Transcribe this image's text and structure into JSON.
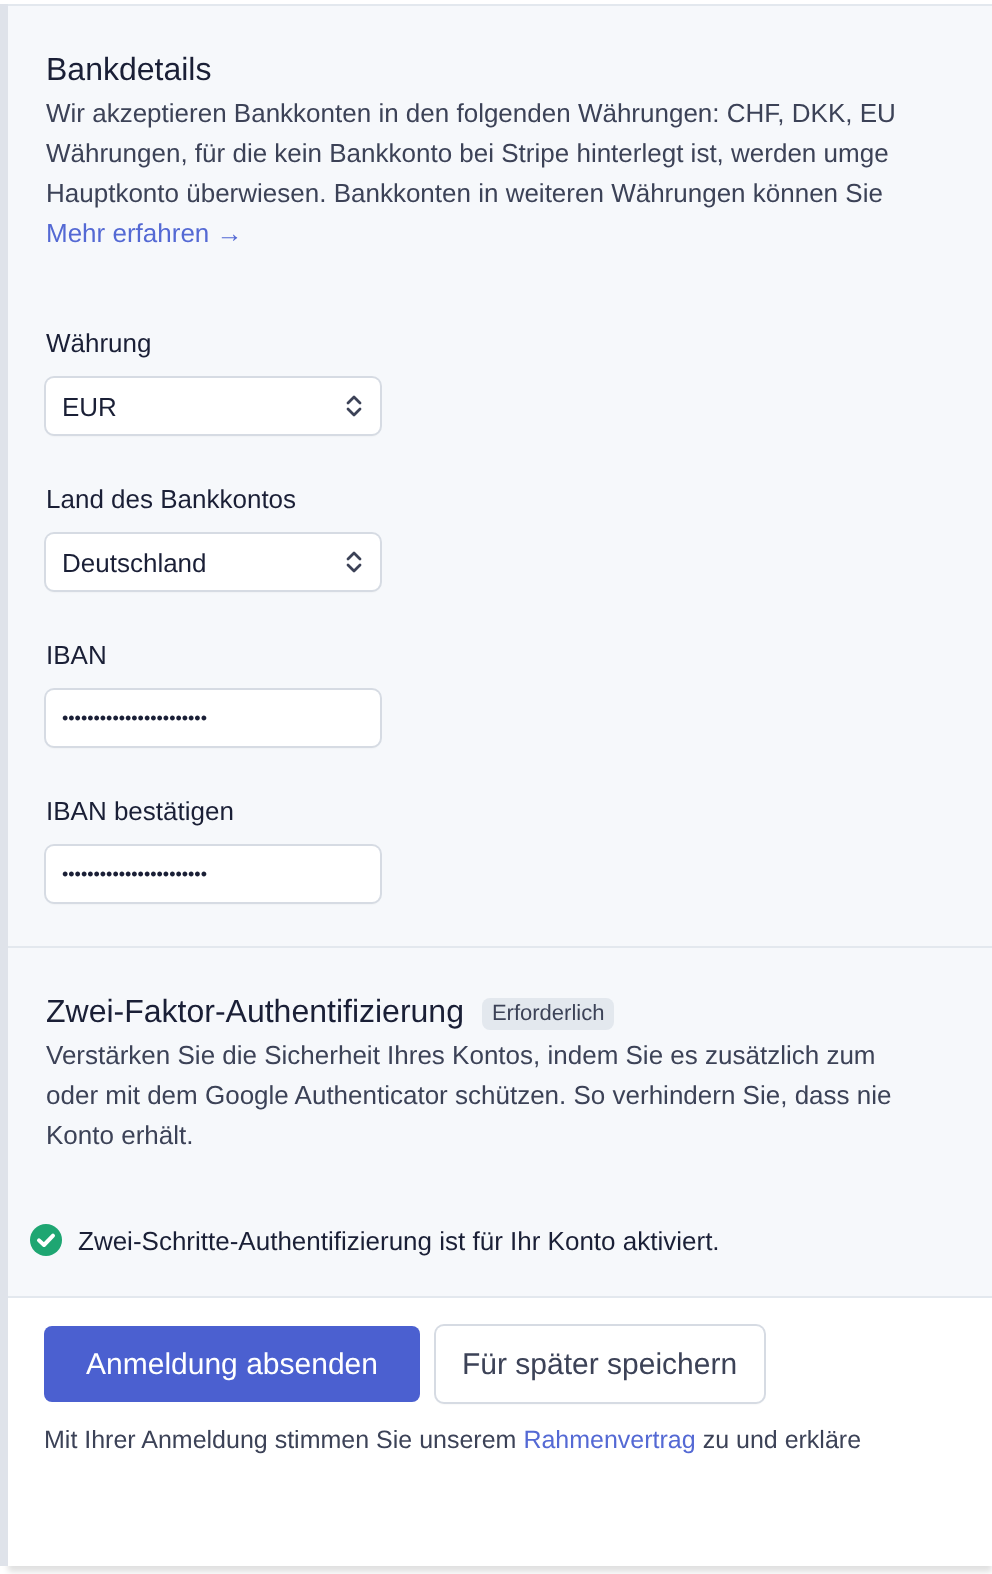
{
  "bank_details": {
    "title": "Bankdetails",
    "description_lines": [
      "Wir akzeptieren Bankkonten in den folgenden Währungen: CHF, DKK, EU",
      "Währungen, für die kein Bankkonto bei Stripe hinterlegt ist, werden umge",
      "Hauptkonto überwiesen. Bankkonten in weiteren Währungen können Sie"
    ],
    "link": "Mehr erfahren →",
    "fields": [
      {
        "kind": "select",
        "label": "Währung",
        "value": "EUR"
      },
      {
        "kind": "select",
        "label": "Land des Bankkontos",
        "value": "Deutschland"
      },
      {
        "kind": "masked",
        "label": "IBAN",
        "value": "•••••••••••••••••••••••"
      },
      {
        "kind": "masked",
        "label": "IBAN bestätigen",
        "value": "•••••••••••••••••••••••"
      }
    ]
  },
  "two_factor": {
    "title": "Zwei-Faktor-Authentifizierung",
    "badge": "Erforderlich",
    "description_lines": [
      "Verstärken Sie die Sicherheit Ihres Kontos, indem Sie es zusätzlich zum",
      "oder mit dem Google Authenticator schützen. So verhindern Sie, dass nie",
      "Konto erhält."
    ],
    "status": {
      "enabled": true,
      "text": "Zwei-Schritte-Authentifizierung ist für Ihr Konto aktiviert."
    }
  },
  "footer": {
    "buttons": [
      {
        "kind": "primary",
        "label": "Anmeldung absenden"
      },
      {
        "kind": "secondary",
        "label": "Für später speichern"
      }
    ],
    "terms_before": "Mit Ihrer Anmeldung stimmen Sie unserem ",
    "terms_link": "Rahmenvertrag",
    "terms_after": " zu und erkläre"
  }
}
